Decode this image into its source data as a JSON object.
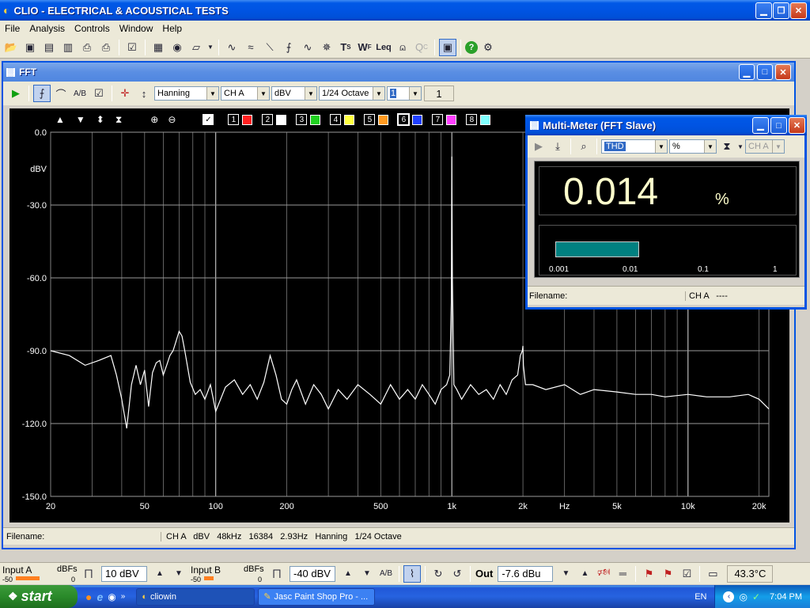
{
  "app": {
    "title": "CLIO - ELECTRICAL & ACOUSTICAL TESTS"
  },
  "menu": [
    "File",
    "Analysis",
    "Controls",
    "Window",
    "Help"
  ],
  "fft": {
    "title": "FFT",
    "window_type": "Hanning",
    "channel": "CH A",
    "unit": "dBV",
    "smoothing": "1/24 Octave",
    "avg_select": "1",
    "avg_count": "1",
    "traces": [
      "1",
      "2",
      "3",
      "4",
      "5",
      "6",
      "7",
      "8"
    ],
    "trace_colors": [
      "#ff2020",
      "#ffffff",
      "#20d020",
      "#ffff40",
      "#ff9a20",
      "#2040ff",
      "#ff40ff",
      "#80ffff"
    ],
    "y_ticks": [
      "0.0",
      "dBV",
      "-30.0",
      "-60.0",
      "-90.0",
      "-120.0",
      "-150.0"
    ],
    "x_ticks": [
      "20",
      "50",
      "100",
      "200",
      "500",
      "1k",
      "2k",
      "Hz",
      "5k",
      "10k",
      "20k"
    ],
    "status": {
      "filename_label": "Filename:",
      "info": "CH A   dBV   48kHz   16384   2.93Hz   Hanning   1/24 Octave"
    }
  },
  "chart_data": {
    "type": "line",
    "xlabel": "Hz",
    "ylabel": "dBV",
    "xscale": "log",
    "xlim": [
      20,
      22000
    ],
    "ylim": [
      -150,
      0
    ],
    "y_ticks": [
      0,
      -30,
      -60,
      -90,
      -120,
      -150
    ],
    "x_ticks": [
      20,
      50,
      100,
      200,
      500,
      1000,
      2000,
      5000,
      10000,
      20000
    ],
    "grid": true,
    "series": [
      {
        "color": "#ffffff",
        "x": [
          20,
          24,
          28,
          32,
          36,
          38,
          40,
          42,
          44,
          46,
          48,
          50,
          52,
          54,
          56,
          58,
          60,
          62,
          64,
          66,
          68,
          70,
          72,
          74,
          78,
          82,
          86,
          90,
          95,
          100,
          110,
          120,
          130,
          140,
          150,
          160,
          170,
          180,
          190,
          200,
          210,
          220,
          240,
          260,
          280,
          300,
          330,
          360,
          400,
          450,
          500,
          550,
          600,
          650,
          700,
          750,
          800,
          850,
          900,
          950,
          980,
          995,
          1000,
          1005,
          1020,
          1050,
          1100,
          1200,
          1300,
          1400,
          1500,
          1600,
          1700,
          1800,
          1900,
          1950,
          1990,
          2000,
          2010,
          2050,
          2200,
          2500,
          3000,
          3500,
          4000,
          5000,
          6000,
          7000,
          8000,
          10000,
          12000,
          15000,
          18000,
          20000,
          22000
        ],
        "y": [
          -90,
          -92,
          -96,
          -94,
          -92,
          -100,
          -110,
          -122,
          -104,
          -96,
          -104,
          -98,
          -113,
          -99,
          -95,
          -94,
          -100,
          -96,
          -92,
          -90,
          -86,
          -82,
          -84,
          -90,
          -103,
          -108,
          -106,
          -110,
          -104,
          -115,
          -105,
          -102,
          -108,
          -104,
          -110,
          -103,
          -92,
          -100,
          -110,
          -112,
          -106,
          -102,
          -112,
          -104,
          -108,
          -114,
          -106,
          -110,
          -104,
          -108,
          -112,
          -104,
          -110,
          -106,
          -110,
          -104,
          -108,
          -112,
          -106,
          -104,
          -100,
          -70,
          -10,
          -60,
          -104,
          -106,
          -110,
          -104,
          -108,
          -106,
          -110,
          -104,
          -108,
          -102,
          -100,
          -92,
          -90,
          -88,
          -96,
          -104,
          -104,
          -106,
          -104,
          -108,
          -106,
          -107,
          -108,
          -108,
          -109,
          -108,
          -109,
          -109,
          -108,
          -110,
          -114
        ]
      }
    ]
  },
  "meter": {
    "title": "Multi-Meter (FFT Slave)",
    "param": "THD",
    "unit_select": "%",
    "channel_select": "CH A",
    "value": "0.014",
    "value_unit": "%",
    "bar_fraction": 0.38,
    "bar_ticks": [
      "0.001",
      "0.01",
      "0.1",
      "1"
    ],
    "filename_label": "Filename:",
    "ch_label": "CH A   ----"
  },
  "bottom": {
    "input_a_label": "Input A",
    "input_a_dbfs": "dBFs",
    "input_a_scale_min": "-50",
    "input_a_scale_max": "0",
    "input_a_range": "10 dBV",
    "input_b_label": "Input B",
    "input_b_dbfs": "dBFs",
    "input_b_scale_min": "-50",
    "input_b_scale_max": "0",
    "input_b_range": "-40 dBV",
    "ab_label": "A/B",
    "out_label": "Out",
    "out_value": "-7.6 dBu",
    "temperature": "43.3°C"
  },
  "taskbar": {
    "start_label": "start",
    "items": [
      "cliowin",
      "Jasc Paint Shop Pro - ..."
    ],
    "lang": "EN",
    "time": "7:04 PM"
  },
  "colors": {
    "xp_blue": "#0054e3",
    "meter_bar": "#008080",
    "meter_text": "#ffffcc"
  }
}
